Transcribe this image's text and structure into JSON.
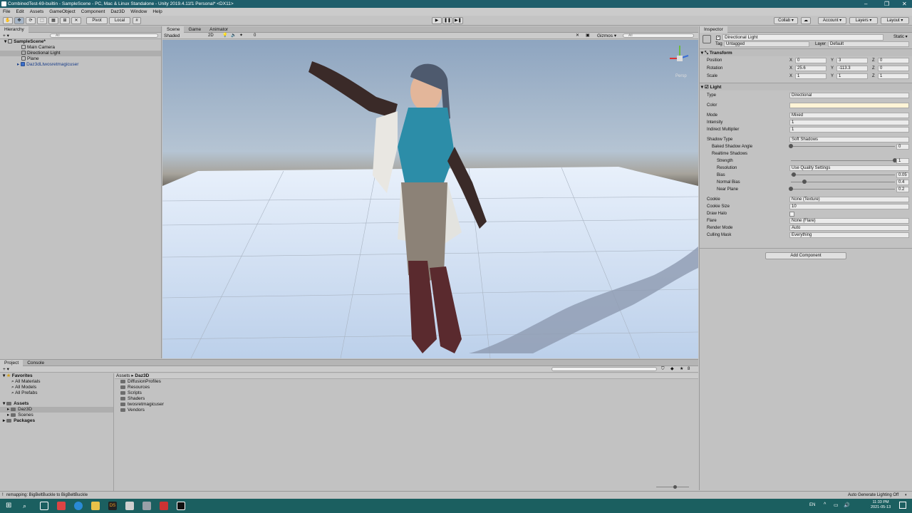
{
  "window": {
    "title": "CombinedTest-69-builtin - SampleScene - PC, Mac & Linux Standalone - Unity 2019.4.11f1 Personal* <DX11>",
    "minimize": "–",
    "maximize": "❐",
    "close": "✕"
  },
  "menu": [
    "File",
    "Edit",
    "Assets",
    "GameObject",
    "Component",
    "Daz3D",
    "Window",
    "Help"
  ],
  "toolbar": {
    "pivot": "Pivot",
    "local": "Local",
    "play": "▶",
    "pause": "❚❚",
    "step": "▶❚",
    "collab": "Collab ▾",
    "account": "Account ▾",
    "layers": "Layers ▾",
    "layout": "Layout ▾"
  },
  "hierarchy": {
    "tab": "Hierarchy",
    "add": "+ ▾",
    "search_placeholder": "All",
    "scene": "SampleScene*",
    "items": [
      "Main Camera",
      "Directional Light",
      "Plane",
      "Daz3dLtwosretmagicuser"
    ]
  },
  "scene": {
    "tabs": [
      "Scene",
      "Game",
      "Animator"
    ],
    "shading": "Shaded",
    "mode2d": "2D",
    "gizmos": "Gizmos ▾",
    "search_placeholder": "All",
    "persp": "Persp",
    "layers_count": "0"
  },
  "inspector": {
    "tab": "Inspector",
    "object_name": "Directional Light",
    "static": "Static ▾",
    "tag_label": "Tag",
    "tag": "Untagged",
    "layer_label": "Layer",
    "layer": "Default",
    "transform": {
      "title": "Transform",
      "position": {
        "label": "Position",
        "x": "0",
        "y": "3",
        "z": "0"
      },
      "rotation": {
        "label": "Rotation",
        "x": "25.6",
        "y": "-113.3",
        "z": "0"
      },
      "scale": {
        "label": "Scale",
        "x": "1",
        "y": "1",
        "z": "1"
      }
    },
    "light": {
      "title": "Light",
      "rows": [
        {
          "label": "Type",
          "value": "Directional"
        },
        {
          "label": "Color",
          "value": ""
        },
        {
          "label": "Mode",
          "value": "Mixed"
        },
        {
          "label": "Intensity",
          "value": "1"
        },
        {
          "label": "Indirect Multiplier",
          "value": "1"
        },
        {
          "label": "Shadow Type",
          "value": "Soft Shadows"
        },
        {
          "label": "Baked Shadow Angle",
          "value": "0"
        },
        {
          "label": "Realtime Shadows",
          "value": ""
        },
        {
          "label": "Strength",
          "value": "1"
        },
        {
          "label": "Resolution",
          "value": "Use Quality Settings"
        },
        {
          "label": "Bias",
          "value": "0.05"
        },
        {
          "label": "Normal Bias",
          "value": "0.4"
        },
        {
          "label": "Near Plane",
          "value": "0.2"
        },
        {
          "label": "Cookie",
          "value": "None (Texture)"
        },
        {
          "label": "Cookie Size",
          "value": "10"
        },
        {
          "label": "Draw Halo",
          "value": ""
        },
        {
          "label": "Flare",
          "value": "None (Flare)"
        },
        {
          "label": "Render Mode",
          "value": "Auto"
        },
        {
          "label": "Culling Mask",
          "value": "Everything"
        }
      ],
      "slider_levels": {
        "baked": 0.0,
        "strength": 1.0,
        "bias": 0.025,
        "normal_bias": 0.13,
        "near_plane": 0.0
      }
    },
    "add_component": "Add Component"
  },
  "project": {
    "tabs": [
      "Project",
      "Console"
    ],
    "favorites": "Favorites",
    "fav_items": [
      "All Materials",
      "All Models",
      "All Prefabs"
    ],
    "assets": "Assets",
    "asset_items": [
      "Daz3D",
      "Scenes"
    ],
    "packages": "Packages",
    "breadcrumb": [
      "Assets",
      "Daz3D"
    ],
    "folders": [
      "DiffusionProfiles",
      "Resources",
      "Scripts",
      "Shaders",
      "twosretmagicuser",
      "Vendors"
    ],
    "count": "8"
  },
  "status": {
    "message": "remapping: BigBeltBuckle to BigBeltBuckle",
    "right": "Auto Generate Lighting Off"
  },
  "taskbar": {
    "lang": "EN",
    "time": "11:33 PM",
    "date": "2021-05-13"
  },
  "colors": {
    "title_bar": "#1e5e6b",
    "taskbar": "#1b5f60",
    "sky_top": "#9db3cc",
    "ground": "#6b6660",
    "plane": "#c9daf0",
    "light_color": "#fff4d6"
  }
}
